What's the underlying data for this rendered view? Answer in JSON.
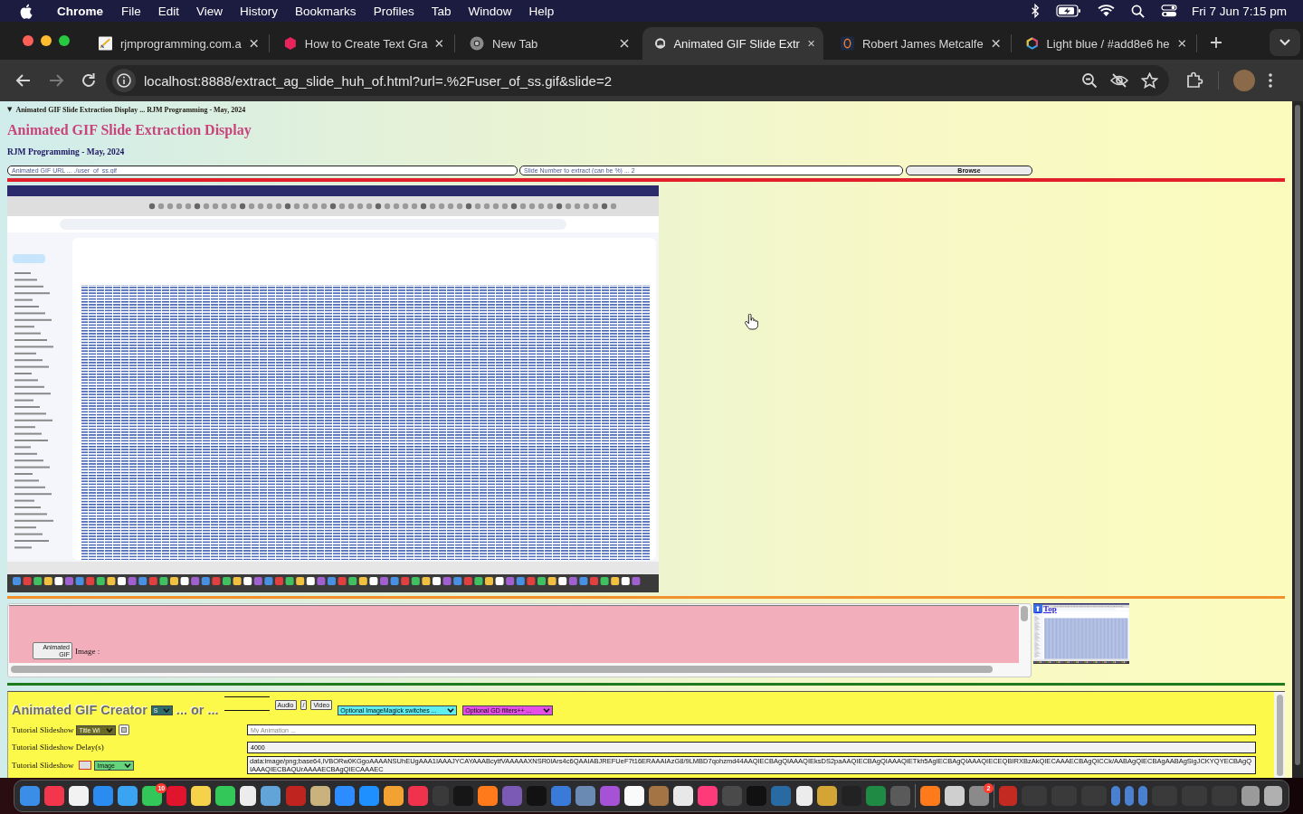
{
  "menu_bar": {
    "app": "Chrome",
    "menus": [
      "File",
      "Edit",
      "View",
      "History",
      "Bookmarks",
      "Profiles",
      "Tab",
      "Window",
      "Help"
    ],
    "clock": "Fri 7 Jun 7:15 pm"
  },
  "tabs": [
    {
      "title": "rjmprogramming.com.a",
      "selected": false
    },
    {
      "title": "How to Create Text Gra",
      "selected": false
    },
    {
      "title": "New Tab",
      "selected": false
    },
    {
      "title": "Animated GIF Slide Extr",
      "selected": true
    },
    {
      "title": "Robert James Metcalfe",
      "selected": false
    },
    {
      "title": "Light blue / #add8e6 he",
      "selected": false
    }
  ],
  "address_bar": {
    "url": "localhost:8888/extract_ag_slide_huh_of.html?url=.%2Fuser_of_ss.gif&slide=2"
  },
  "page": {
    "summary": {
      "marker": "▼",
      "text": "Animated GIF Slide Extraction Display ... RJM Programming - May, 2024"
    },
    "title": "Animated GIF Slide Extraction Display",
    "subtitle": "RJM Programming - May, 2024",
    "url_field": {
      "placeholder": "Animated GIF URL ... ./user_of_ss.gif"
    },
    "slide_field": {
      "placeholder": "Slide Number to extract (can be %) ... 2"
    },
    "browse_button": "Browse",
    "slide_panel": {
      "button": "Animated GIF",
      "label": "Image :"
    },
    "top_link": {
      "icon": "⬆",
      "text": "Top"
    },
    "creator": {
      "title": "Animated GIF Creator",
      "mode_select": "S",
      "or_text": "... or ...",
      "media_buttons": [
        "Audio",
        "/",
        "Video"
      ],
      "imagemagick_select": "Optional ImageMagick switches ...",
      "gd_select": "Optional GD filters++ ...",
      "rows": [
        {
          "kind": "title",
          "label": "Tutorial Slideshow",
          "select": "Title Wi",
          "placeholder": "My Animation ..."
        },
        {
          "kind": "delay",
          "label": "Tutorial Slideshow Delay(s)",
          "value": "4000"
        },
        {
          "kind": "image",
          "label": "Tutorial Slideshow",
          "select": "Image",
          "value": "data:image/png;base64,iVBORw0KGgoAAAANSUhEUgAAA1IAAAJYCAYAAABcytfVAAAAAXNSR0IArs4c6QAAIABJREFUeF7t16ERAAAIAzG8/9LMBD7qohzmd44AAQIECBAgQIAAAQIEksDS2paAAQIECBAgQIAAAQIETkh5AgIECBAgQIAAAQIECEQBIRXBzAkQIECAAAECBAgQICCk/AABAgQIECBAgAABAgSigJCKYQYECBAgQIAAAQIECBAQUrAAAAECBAgQIECAAAEC"
        }
      ]
    }
  },
  "dock": {
    "messages_badge": "10",
    "settings_badge": "2"
  }
}
